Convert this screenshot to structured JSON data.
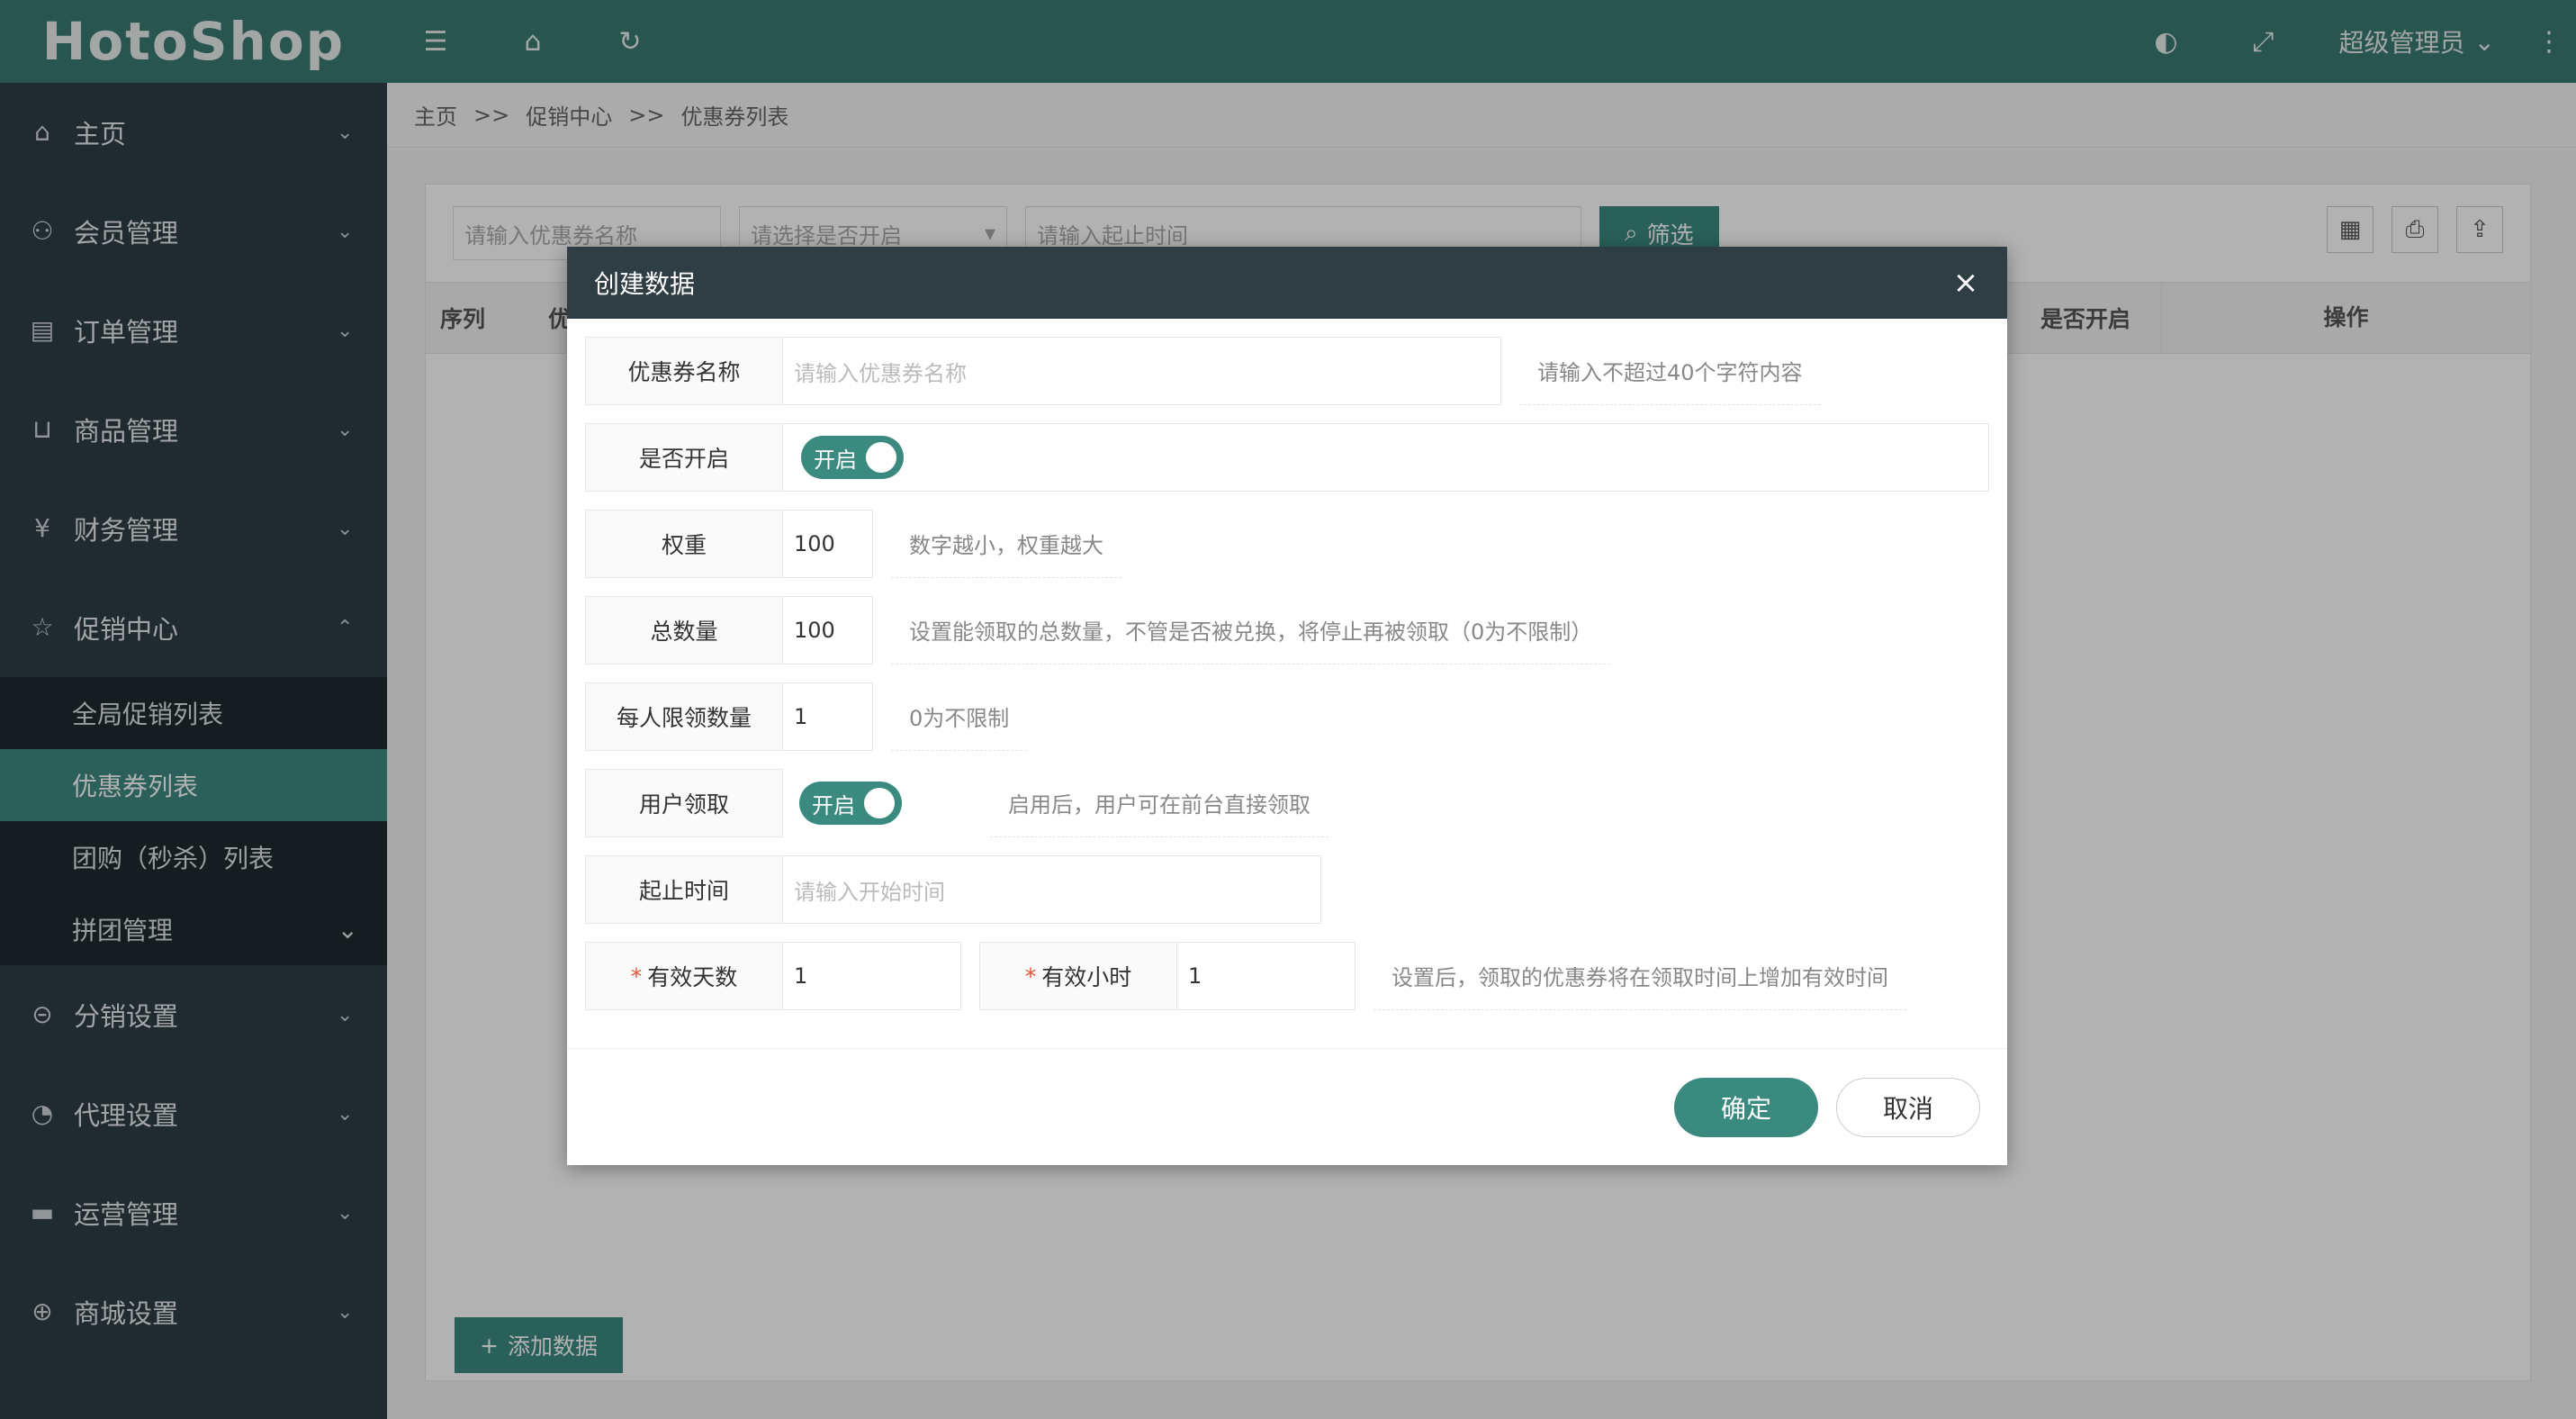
{
  "app": {
    "logo": "HotoShop"
  },
  "topbar": {
    "user": "超级管理员"
  },
  "sidebar": {
    "items": [
      {
        "label": "主页",
        "icon": "home-icon"
      },
      {
        "label": "会员管理",
        "icon": "user-icon"
      },
      {
        "label": "订单管理",
        "icon": "order-icon"
      },
      {
        "label": "商品管理",
        "icon": "cart-icon"
      },
      {
        "label": "财务管理",
        "icon": "yen-icon"
      },
      {
        "label": "促销中心",
        "icon": "star-icon"
      },
      {
        "label": "分销设置",
        "icon": "share-icon"
      },
      {
        "label": "代理设置",
        "icon": "gauge-icon"
      },
      {
        "label": "运营管理",
        "icon": "screen-icon"
      },
      {
        "label": "商城设置",
        "icon": "globe-icon"
      }
    ],
    "promo_sub": [
      "全局促销列表",
      "优惠券列表",
      "团购（秒杀）列表",
      "拼团管理"
    ]
  },
  "breadcrumb": {
    "home": "主页",
    "sep": ">>",
    "level1": "促销中心",
    "level2": "优惠券列表"
  },
  "filter": {
    "name_placeholder": "请输入优惠券名称",
    "open_placeholder": "请选择是否开启",
    "time_placeholder": "请输入起止时间",
    "button": "筛选"
  },
  "table": {
    "col_index": "序列",
    "col_name": "优",
    "col_open": "是否开启",
    "col_action": "操作"
  },
  "add_button": "添加数据",
  "modal": {
    "title": "创建数据",
    "fields": {
      "name_label": "优惠券名称",
      "name_placeholder": "请输入优惠券名称",
      "name_hint": "请输入不超过40个字符内容",
      "open_label": "是否开启",
      "open_toggle": "开启",
      "weight_label": "权重",
      "weight_value": "100",
      "weight_hint": "数字越小，权重越大",
      "total_label": "总数量",
      "total_value": "100",
      "total_hint": "设置能领取的总数量，不管是否被兑换，将停止再被领取（0为不限制）",
      "limit_label": "每人限领数量",
      "limit_value": "1",
      "limit_hint": "0为不限制",
      "user_label": "用户领取",
      "user_toggle": "开启",
      "user_hint": "启用后，用户可在前台直接领取",
      "time_label": "起止时间",
      "time_placeholder": "请输入开始时间",
      "days_label": "有效天数",
      "days_value": "1",
      "hours_label": "有效小时",
      "hours_value": "1",
      "valid_hint": "设置后，领取的优惠券将在领取时间上增加有效时间",
      "required_mark": "*"
    },
    "ok": "确定",
    "cancel": "取消"
  },
  "colors": {
    "primary": "#3b8a80",
    "header": "#3b7a72",
    "sidebar": "#2f3e44"
  }
}
